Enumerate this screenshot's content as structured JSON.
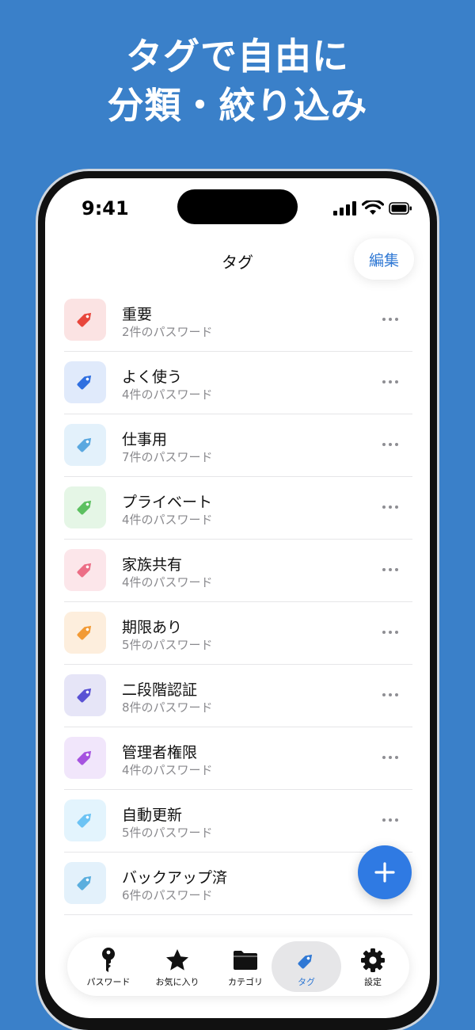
{
  "promo": {
    "line1": "タグで自由に",
    "line2": "分類・絞り込み"
  },
  "status_bar": {
    "time": "9:41"
  },
  "nav": {
    "title": "タグ",
    "edit_label": "編集"
  },
  "tags": [
    {
      "name": "重要",
      "count": "2件のパスワード",
      "color": "#e8463c",
      "bg": "#fbe3e3"
    },
    {
      "name": "よく使う",
      "count": "4件のパスワード",
      "color": "#2f6fe0",
      "bg": "#e0eafb"
    },
    {
      "name": "仕事用",
      "count": "7件のパスワード",
      "color": "#5aa8e0",
      "bg": "#e3f1fb"
    },
    {
      "name": "プライベート",
      "count": "4件のパスワード",
      "color": "#5cc060",
      "bg": "#e5f6e6"
    },
    {
      "name": "家族共有",
      "count": "4件のパスワード",
      "color": "#ec6e86",
      "bg": "#fce6ea"
    },
    {
      "name": "期限あり",
      "count": "5件のパスワード",
      "color": "#f29a35",
      "bg": "#fdeedd"
    },
    {
      "name": "二段階認証",
      "count": "8件のパスワード",
      "color": "#5a52d4",
      "bg": "#e6e5f7"
    },
    {
      "name": "管理者権限",
      "count": "4件のパスワード",
      "color": "#a653e0",
      "bg": "#f1e6fb"
    },
    {
      "name": "自動更新",
      "count": "5件のパスワード",
      "color": "#6cc3f4",
      "bg": "#e3f4fd"
    },
    {
      "name": "バックアップ済",
      "count": "6件のパスワード",
      "color": "#5aaede",
      "bg": "#e3f1fb"
    }
  ],
  "fab": {
    "icon": "plus-icon"
  },
  "tab_bar": {
    "items": [
      {
        "label": "パスワード",
        "icon": "key-icon"
      },
      {
        "label": "お気に入り",
        "icon": "star-icon"
      },
      {
        "label": "カテゴリ",
        "icon": "folder-icon"
      },
      {
        "label": "タグ",
        "icon": "tag-icon",
        "active": true
      },
      {
        "label": "設定",
        "icon": "gear-icon"
      }
    ],
    "accent": "#2f78d4"
  }
}
